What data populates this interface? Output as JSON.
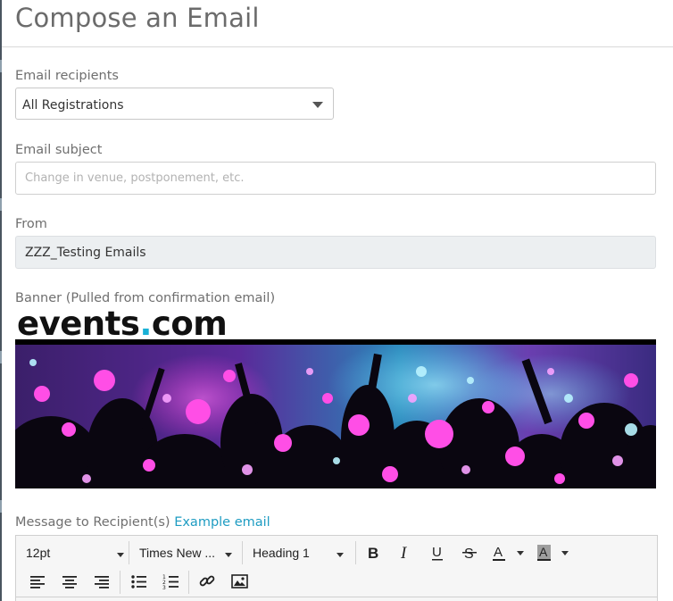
{
  "page": {
    "title": "Compose an Email"
  },
  "recipients": {
    "label": "Email recipients",
    "selected": "All Registrations"
  },
  "subject": {
    "label": "Email subject",
    "placeholder": "Change in venue, postponement, etc.",
    "value": ""
  },
  "from": {
    "label": "From",
    "value": "ZZZ_Testing Emails"
  },
  "banner": {
    "label": "Banner (Pulled from confirmation email)",
    "logo_main": "events",
    "logo_dot": ".",
    "logo_tld": "com"
  },
  "message": {
    "label": "Message to Recipient(s)",
    "example_link": "Example email"
  },
  "toolbar": {
    "font_size": "12pt",
    "font_family": "Times New ...",
    "block_format": "Heading 1",
    "icons": [
      "bold-icon",
      "italic-icon",
      "underline-icon",
      "strikethrough-icon",
      "text-color-icon",
      "background-color-icon",
      "align-left-icon",
      "align-center-icon",
      "align-right-icon",
      "bullet-list-icon",
      "numbered-list-icon",
      "link-icon",
      "image-icon"
    ]
  },
  "colors": {
    "accent_link": "#1e9cc2",
    "logo_dot": "#19b1d6",
    "readonly_bg": "#eceff1"
  }
}
